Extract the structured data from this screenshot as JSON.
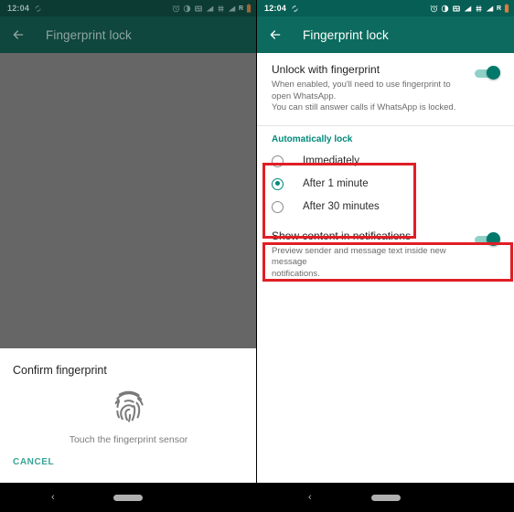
{
  "statusbar": {
    "time": "12:04",
    "icons": [
      "sync-icon",
      "alarm-icon",
      "contrast-icon",
      "screenshot-icon",
      "signal-icon-1",
      "vibrate-icon",
      "signal-icon-2",
      "roaming-letter",
      "battery-icon"
    ],
    "roaming_label": "R"
  },
  "appbar": {
    "back_icon": "back-arrow-icon",
    "title": "Fingerprint lock"
  },
  "unlock_pref": {
    "title": "Unlock with fingerprint",
    "subtitle_line1": "When enabled, you'll need to use fingerprint to open WhatsApp.",
    "subtitle_line2": "You can still answer calls if WhatsApp is locked.",
    "left_state": "off",
    "right_state": "on"
  },
  "autolock": {
    "section_label": "Automatically lock",
    "options": [
      {
        "label": "Immediately",
        "selected": false
      },
      {
        "label": "After 1 minute",
        "selected": true
      },
      {
        "label": "After 30 minutes",
        "selected": false
      }
    ]
  },
  "notifications_pref": {
    "title": "Show content in notifications",
    "subtitle_line1": "Preview sender and message text inside new message",
    "subtitle_line2": "notifications.",
    "state": "on"
  },
  "fingerprint_sheet": {
    "title": "Confirm fingerprint",
    "icon": "fingerprint-icon",
    "hint": "Touch the fingerprint sensor",
    "cancel_label": "CANCEL"
  },
  "navbar": {
    "back_glyph": "‹",
    "home_pill": "home-pill"
  },
  "colors": {
    "appbar_teal": "#0c6b5e",
    "statusbar_teal": "#075E54",
    "accent_teal": "#00897B",
    "annotation_red": "#e01f26",
    "scrim_gray": "#666666"
  }
}
